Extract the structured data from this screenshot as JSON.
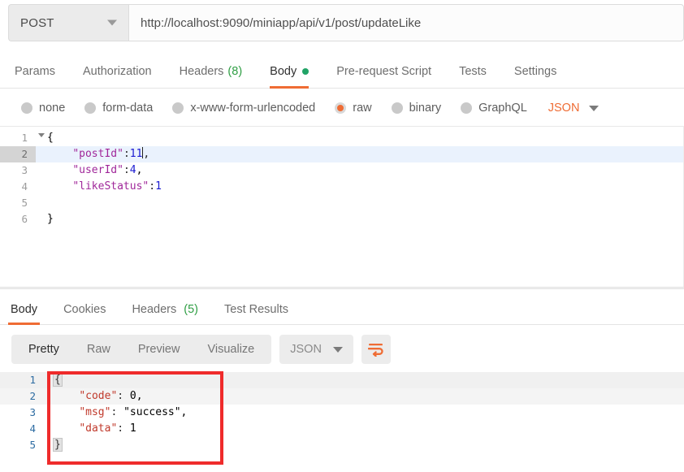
{
  "request": {
    "method": "POST",
    "method_caret_icon": "chevron-down-icon",
    "url": "http://localhost:9090/miniapp/api/v1/post/updateLike",
    "tabs": [
      {
        "label": "Params",
        "active": false,
        "count": null,
        "dot": false
      },
      {
        "label": "Authorization",
        "active": false,
        "count": null,
        "dot": false
      },
      {
        "label": "Headers",
        "active": false,
        "count": "(8)",
        "dot": false
      },
      {
        "label": "Body",
        "active": true,
        "count": null,
        "dot": true
      },
      {
        "label": "Pre-request Script",
        "active": false,
        "count": null,
        "dot": false
      },
      {
        "label": "Tests",
        "active": false,
        "count": null,
        "dot": false
      },
      {
        "label": "Settings",
        "active": false,
        "count": null,
        "dot": false
      }
    ],
    "body_types": [
      {
        "label": "none",
        "selected": false
      },
      {
        "label": "form-data",
        "selected": false
      },
      {
        "label": "x-www-form-urlencoded",
        "selected": false
      },
      {
        "label": "raw",
        "selected": true
      },
      {
        "label": "binary",
        "selected": false
      },
      {
        "label": "GraphQL",
        "selected": false
      }
    ],
    "format": {
      "label": "JSON",
      "caret_icon": "chevron-down-icon"
    },
    "body_lines": [
      {
        "num": "1",
        "foldable": true,
        "highlighted": false,
        "text": "{"
      },
      {
        "num": "2",
        "foldable": false,
        "highlighted": true,
        "text": "    \"postId\":11,"
      },
      {
        "num": "3",
        "foldable": false,
        "highlighted": false,
        "text": "    \"userId\":4,"
      },
      {
        "num": "4",
        "foldable": false,
        "highlighted": false,
        "text": "    \"likeStatus\":1"
      },
      {
        "num": "5",
        "foldable": false,
        "highlighted": false,
        "text": ""
      },
      {
        "num": "6",
        "foldable": false,
        "highlighted": false,
        "text": "}"
      }
    ]
  },
  "response": {
    "tabs": [
      {
        "label": "Body",
        "active": true,
        "count": null
      },
      {
        "label": "Cookies",
        "active": false,
        "count": null
      },
      {
        "label": "Headers",
        "active": false,
        "count": "(5)"
      },
      {
        "label": "Test Results",
        "active": false,
        "count": null
      }
    ],
    "view_modes": [
      {
        "label": "Pretty",
        "active": true
      },
      {
        "label": "Raw",
        "active": false
      },
      {
        "label": "Preview",
        "active": false
      },
      {
        "label": "Visualize",
        "active": false
      }
    ],
    "format": {
      "label": "JSON",
      "caret_icon": "chevron-down-icon"
    },
    "wrap_button_icon": "word-wrap-icon",
    "body_lines": [
      {
        "num": "1",
        "text": "{"
      },
      {
        "num": "2",
        "text": "    \"code\": 0,"
      },
      {
        "num": "3",
        "text": "    \"msg\": \"success\","
      },
      {
        "num": "4",
        "text": "    \"data\": 1"
      },
      {
        "num": "5",
        "text": "}"
      }
    ]
  },
  "annotation": {
    "type": "red-rectangle-highlight"
  },
  "colors": {
    "accent_orange": "#ef6c34",
    "green_badge": "#2f9e44",
    "annotation_red": "#ef2b2b",
    "req_key": "#a0279a",
    "req_number": "#1a1ad1",
    "res_key": "#c0392b",
    "res_number": "#1d8348",
    "res_string": "#2e74c9",
    "res_gutter": "#2d6ca2"
  }
}
